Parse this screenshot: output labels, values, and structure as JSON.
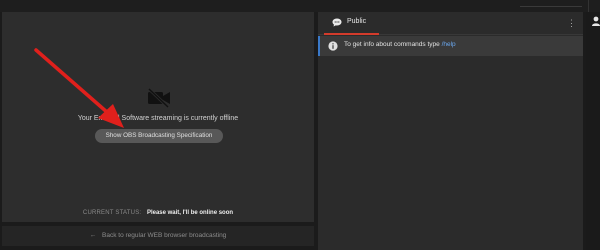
{
  "video": {
    "offline_message": "Your External Software streaming is currently offline",
    "spec_button_label": "Show OBS Broadcasting Specification",
    "status_label": "CURRENT STATUS:",
    "status_value": "Please wait, I'll be online soon"
  },
  "back_button": {
    "arrow": "←",
    "label": "Back to regular WEB browser broadcasting"
  },
  "chat": {
    "tab_label": "Public",
    "menu_glyph": "⋮",
    "message_text": "To get info about commands type ",
    "message_link": "/help"
  },
  "colors": {
    "accent_tab": "#d33b2b",
    "info_border": "#3a79c9",
    "link": "#6aa8ef",
    "annotation_arrow": "#e0201c"
  },
  "icons": {
    "camera_off": "video-off-icon",
    "chat": "chat-bubble-icon",
    "info": "info-icon",
    "user": "user-icon"
  }
}
